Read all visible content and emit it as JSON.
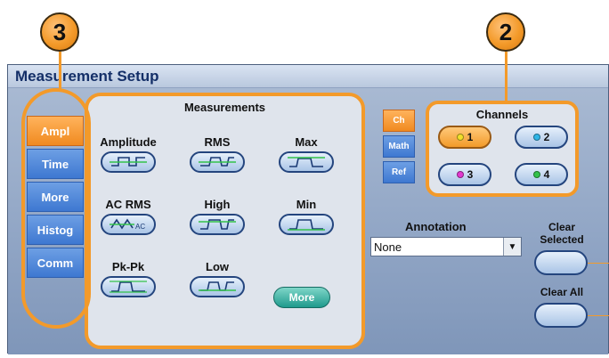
{
  "callouts": [
    "3",
    "2"
  ],
  "window": {
    "title": "Measurement Setup"
  },
  "side_tabs": [
    {
      "label": "Ampl",
      "active": true
    },
    {
      "label": "Time",
      "active": false
    },
    {
      "label": "More",
      "active": false
    },
    {
      "label": "Histog",
      "active": false
    },
    {
      "label": "Comm",
      "active": false
    }
  ],
  "measurements": {
    "title": "Measurements",
    "items": [
      {
        "label": "Amplitude",
        "icon": "amplitude-waveform-icon"
      },
      {
        "label": "RMS",
        "icon": "rms-waveform-icon"
      },
      {
        "label": "Max",
        "icon": "max-waveform-icon"
      },
      {
        "label": "AC RMS",
        "icon": "ac-rms-waveform-icon"
      },
      {
        "label": "High",
        "icon": "high-waveform-icon"
      },
      {
        "label": "Min",
        "icon": "min-waveform-icon"
      },
      {
        "label": "Pk-Pk",
        "icon": "pk-pk-waveform-icon"
      },
      {
        "label": "Low",
        "icon": "low-waveform-icon"
      }
    ],
    "more_label": "More"
  },
  "channel_tabs": [
    {
      "label": "Ch",
      "active": true
    },
    {
      "label": "Math",
      "active": false
    },
    {
      "label": "Ref",
      "active": false
    }
  ],
  "channels": {
    "title": "Channels",
    "items": [
      {
        "label": "1",
        "color": "#f2e02a",
        "selected": true
      },
      {
        "label": "2",
        "color": "#2fb6e8",
        "selected": false
      },
      {
        "label": "3",
        "color": "#e23ad0",
        "selected": false
      },
      {
        "label": "4",
        "color": "#33c24a",
        "selected": false
      }
    ]
  },
  "annotation": {
    "label": "Annotation",
    "value": "None",
    "arrow": "▼"
  },
  "clear_selected": {
    "label_line1": "Clear",
    "label_line2": "Selected"
  },
  "clear_all": {
    "label": "Clear All"
  },
  "colors": {
    "accent": "#f39a2a",
    "tab_blue": "#3e78d1",
    "panel": "#dfe4ec"
  }
}
